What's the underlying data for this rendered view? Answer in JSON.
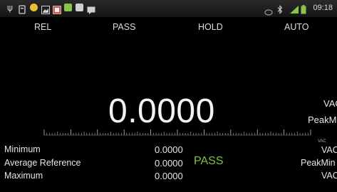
{
  "status_bar": {
    "time": "09:18",
    "icons": [
      "usb-icon",
      "notification-icon",
      "app-icon",
      "image-icon",
      "gallery-icon",
      "app-icon-2",
      "app-icon-3",
      "message-icon",
      "nfc-icon",
      "bluetooth-icon",
      "signal-icon",
      "battery-icon"
    ],
    "colors": {
      "app_green": "#8bc34a",
      "app_yellow": "#e8c234",
      "app_red": "#d8504b"
    }
  },
  "modes": {
    "rel": "REL",
    "pass": "PASS",
    "hold": "HOLD",
    "auto": "AUTO"
  },
  "main": {
    "reading": "0.0000",
    "unit": "VAC",
    "mode": "PeakMax"
  },
  "scale": {
    "unit": "VAC"
  },
  "stats": {
    "rows": [
      {
        "label": "Minimum",
        "value": "0.0000",
        "right": "VAC"
      },
      {
        "label": "Average  Reference",
        "value": "0.0000",
        "right": "PeakMin"
      },
      {
        "label": "Maximum",
        "value": "0.0000",
        "right": "VAC"
      }
    ],
    "pass_label": "PASS",
    "pass_color": "#7dc243"
  }
}
